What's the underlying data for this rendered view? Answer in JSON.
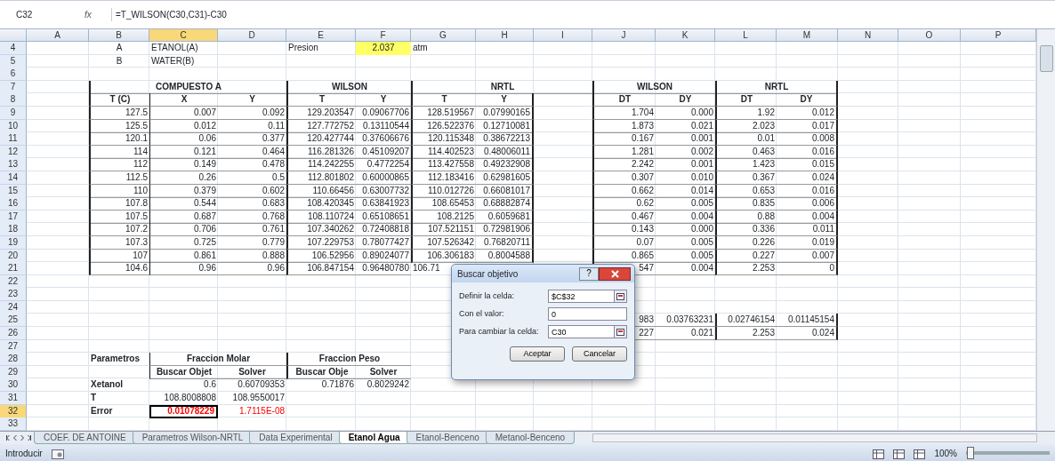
{
  "formula_bar": {
    "name_box": "C32",
    "function_label": "fx",
    "formula": "=T_WILSON(C30,C31)-C30"
  },
  "columns": [
    {
      "letter": "A",
      "selected": false
    },
    {
      "letter": "B",
      "selected": false
    },
    {
      "letter": "C",
      "selected": true
    },
    {
      "letter": "D",
      "selected": false
    },
    {
      "letter": "E",
      "selected": false
    },
    {
      "letter": "F",
      "selected": false
    },
    {
      "letter": "G",
      "selected": false
    },
    {
      "letter": "H",
      "selected": false
    },
    {
      "letter": "I",
      "selected": false
    },
    {
      "letter": "J",
      "selected": false
    },
    {
      "letter": "K",
      "selected": false
    },
    {
      "letter": "L",
      "selected": false
    },
    {
      "letter": "M",
      "selected": false
    },
    {
      "letter": "N",
      "selected": false
    },
    {
      "letter": "O",
      "selected": false
    },
    {
      "letter": "P",
      "selected": false
    }
  ],
  "rows": [
    {
      "number": "4",
      "selected": false,
      "cells": {
        "B": {
          "text": "A",
          "kind": "center"
        },
        "C": {
          "text": "ETANOL(A)",
          "kind": "label"
        },
        "E": {
          "text": "Presion",
          "kind": "label"
        },
        "F": {
          "text": "2.037",
          "kind": "input"
        },
        "G": {
          "text": "atm",
          "kind": "label"
        }
      }
    },
    {
      "number": "5",
      "selected": false,
      "cells": {
        "B": {
          "text": "B",
          "kind": "center"
        },
        "C": {
          "text": "WATER(B)",
          "kind": "label"
        }
      }
    },
    {
      "number": "6",
      "selected": false,
      "cells": {}
    },
    {
      "number": "7",
      "selected": false,
      "cells": {
        "B": {
          "text": "COMPUESTO A",
          "kind": "group"
        },
        "E": {
          "text": "WILSON",
          "kind": "group"
        },
        "G": {
          "text": "NRTL",
          "kind": "group"
        },
        "J": {
          "text": "WILSON",
          "kind": "group"
        },
        "L": {
          "text": "NRTL",
          "kind": "group"
        }
      }
    },
    {
      "number": "8",
      "selected": false,
      "cells": {
        "B": {
          "text": "T (C)",
          "kind": "head"
        },
        "C": {
          "text": "X",
          "kind": "head"
        },
        "D": {
          "text": "Y",
          "kind": "head"
        },
        "E": {
          "text": "T",
          "kind": "head"
        },
        "F": {
          "text": "Y",
          "kind": "head"
        },
        "G": {
          "text": "T",
          "kind": "head"
        },
        "H": {
          "text": "Y",
          "kind": "head"
        },
        "J": {
          "text": "DT",
          "kind": "head"
        },
        "K": {
          "text": "DY",
          "kind": "head"
        },
        "L": {
          "text": "DT",
          "kind": "head"
        },
        "M": {
          "text": "DY",
          "kind": "head"
        }
      }
    },
    {
      "number": "9",
      "selected": false,
      "cells": {
        "B": {
          "text": "127.5",
          "kind": "num"
        },
        "C": {
          "text": "0.007",
          "kind": "num"
        },
        "D": {
          "text": "0.092",
          "kind": "num"
        },
        "E": {
          "text": "129.203547",
          "kind": "num"
        },
        "F": {
          "text": "0.09067706",
          "kind": "num"
        },
        "G": {
          "text": "128.519567",
          "kind": "num"
        },
        "H": {
          "text": "0.07990165",
          "kind": "num"
        },
        "J": {
          "text": "1.704",
          "kind": "num"
        },
        "K": {
          "text": "0.000",
          "kind": "num"
        },
        "L": {
          "text": "1.92",
          "kind": "num"
        },
        "M": {
          "text": "0.012",
          "kind": "num"
        }
      }
    },
    {
      "number": "10",
      "selected": false,
      "cells": {
        "B": {
          "text": "125.5",
          "kind": "num"
        },
        "C": {
          "text": "0.012",
          "kind": "num"
        },
        "D": {
          "text": "0.11",
          "kind": "num"
        },
        "E": {
          "text": "127.772752",
          "kind": "num"
        },
        "F": {
          "text": "0.13110544",
          "kind": "num"
        },
        "G": {
          "text": "126.522376",
          "kind": "num"
        },
        "H": {
          "text": "0.12710081",
          "kind": "num"
        },
        "J": {
          "text": "1.873",
          "kind": "num"
        },
        "K": {
          "text": "0.021",
          "kind": "num"
        },
        "L": {
          "text": "2.023",
          "kind": "num"
        },
        "M": {
          "text": "0.017",
          "kind": "num"
        }
      }
    },
    {
      "number": "11",
      "selected": false,
      "cells": {
        "B": {
          "text": "120.1",
          "kind": "num"
        },
        "C": {
          "text": "0.06",
          "kind": "num"
        },
        "D": {
          "text": "0.377",
          "kind": "num"
        },
        "E": {
          "text": "120.427744",
          "kind": "num"
        },
        "F": {
          "text": "0.37606676",
          "kind": "num"
        },
        "G": {
          "text": "120.115348",
          "kind": "num"
        },
        "H": {
          "text": "0.38672213",
          "kind": "num"
        },
        "J": {
          "text": "0.167",
          "kind": "num"
        },
        "K": {
          "text": "0.001",
          "kind": "num"
        },
        "L": {
          "text": "0.01",
          "kind": "num"
        },
        "M": {
          "text": "0.008",
          "kind": "num"
        }
      }
    },
    {
      "number": "12",
      "selected": false,
      "cells": {
        "B": {
          "text": "114",
          "kind": "num"
        },
        "C": {
          "text": "0.121",
          "kind": "num"
        },
        "D": {
          "text": "0.464",
          "kind": "num"
        },
        "E": {
          "text": "116.281326",
          "kind": "num"
        },
        "F": {
          "text": "0.45109207",
          "kind": "num"
        },
        "G": {
          "text": "114.402523",
          "kind": "num"
        },
        "H": {
          "text": "0.48006011",
          "kind": "num"
        },
        "J": {
          "text": "1.281",
          "kind": "num"
        },
        "K": {
          "text": "0.002",
          "kind": "num"
        },
        "L": {
          "text": "0.463",
          "kind": "num"
        },
        "M": {
          "text": "0.016",
          "kind": "num"
        }
      }
    },
    {
      "number": "13",
      "selected": false,
      "cells": {
        "B": {
          "text": "112",
          "kind": "num"
        },
        "C": {
          "text": "0.149",
          "kind": "num"
        },
        "D": {
          "text": "0.478",
          "kind": "num"
        },
        "E": {
          "text": "114.242255",
          "kind": "num"
        },
        "F": {
          "text": "0.4772254",
          "kind": "num"
        },
        "G": {
          "text": "113.427558",
          "kind": "num"
        },
        "H": {
          "text": "0.49232908",
          "kind": "num"
        },
        "J": {
          "text": "2.242",
          "kind": "num"
        },
        "K": {
          "text": "0.001",
          "kind": "num"
        },
        "L": {
          "text": "1.423",
          "kind": "num"
        },
        "M": {
          "text": "0.015",
          "kind": "num"
        }
      }
    },
    {
      "number": "14",
      "selected": false,
      "cells": {
        "B": {
          "text": "112.5",
          "kind": "num"
        },
        "C": {
          "text": "0.26",
          "kind": "num"
        },
        "D": {
          "text": "0.5",
          "kind": "num"
        },
        "E": {
          "text": "112.801802",
          "kind": "num"
        },
        "F": {
          "text": "0.60000865",
          "kind": "num"
        },
        "G": {
          "text": "112.183416",
          "kind": "num"
        },
        "H": {
          "text": "0.62981605",
          "kind": "num"
        },
        "J": {
          "text": "0.307",
          "kind": "num"
        },
        "K": {
          "text": "0.010",
          "kind": "num"
        },
        "L": {
          "text": "0.367",
          "kind": "num"
        },
        "M": {
          "text": "0.024",
          "kind": "num"
        }
      }
    },
    {
      "number": "15",
      "selected": false,
      "cells": {
        "B": {
          "text": "110",
          "kind": "num"
        },
        "C": {
          "text": "0.379",
          "kind": "num"
        },
        "D": {
          "text": "0.602",
          "kind": "num"
        },
        "E": {
          "text": "110.66456",
          "kind": "num"
        },
        "F": {
          "text": "0.63007732",
          "kind": "num"
        },
        "G": {
          "text": "110.012726",
          "kind": "num"
        },
        "H": {
          "text": "0.66081017",
          "kind": "num"
        },
        "J": {
          "text": "0.662",
          "kind": "num"
        },
        "K": {
          "text": "0.014",
          "kind": "num"
        },
        "L": {
          "text": "0.653",
          "kind": "num"
        },
        "M": {
          "text": "0.016",
          "kind": "num"
        }
      }
    },
    {
      "number": "16",
      "selected": false,
      "cells": {
        "B": {
          "text": "107.8",
          "kind": "num"
        },
        "C": {
          "text": "0.544",
          "kind": "num"
        },
        "D": {
          "text": "0.683",
          "kind": "num"
        },
        "E": {
          "text": "108.420345",
          "kind": "num"
        },
        "F": {
          "text": "0.63841923",
          "kind": "num"
        },
        "G": {
          "text": "108.65453",
          "kind": "num"
        },
        "H": {
          "text": "0.68882874",
          "kind": "num"
        },
        "J": {
          "text": "0.62",
          "kind": "num"
        },
        "K": {
          "text": "0.005",
          "kind": "num"
        },
        "L": {
          "text": "0.835",
          "kind": "num"
        },
        "M": {
          "text": "0.006",
          "kind": "num"
        }
      }
    },
    {
      "number": "17",
      "selected": false,
      "cells": {
        "B": {
          "text": "107.5",
          "kind": "num"
        },
        "C": {
          "text": "0.687",
          "kind": "num"
        },
        "D": {
          "text": "0.768",
          "kind": "num"
        },
        "E": {
          "text": "108.110724",
          "kind": "num"
        },
        "F": {
          "text": "0.65108651",
          "kind": "num"
        },
        "G": {
          "text": "108.2125",
          "kind": "num"
        },
        "H": {
          "text": "0.6059681",
          "kind": "num"
        },
        "J": {
          "text": "0.467",
          "kind": "num"
        },
        "K": {
          "text": "0.004",
          "kind": "num"
        },
        "L": {
          "text": "0.88",
          "kind": "num"
        },
        "M": {
          "text": "0.004",
          "kind": "num"
        }
      }
    },
    {
      "number": "18",
      "selected": false,
      "cells": {
        "B": {
          "text": "107.2",
          "kind": "num"
        },
        "C": {
          "text": "0.706",
          "kind": "num"
        },
        "D": {
          "text": "0.761",
          "kind": "num"
        },
        "E": {
          "text": "107.340262",
          "kind": "num"
        },
        "F": {
          "text": "0.72408818",
          "kind": "num"
        },
        "G": {
          "text": "107.521151",
          "kind": "num"
        },
        "H": {
          "text": "0.72981906",
          "kind": "num"
        },
        "J": {
          "text": "0.143",
          "kind": "num"
        },
        "K": {
          "text": "0.000",
          "kind": "num"
        },
        "L": {
          "text": "0.336",
          "kind": "num"
        },
        "M": {
          "text": "0.011",
          "kind": "num"
        }
      }
    },
    {
      "number": "19",
      "selected": false,
      "cells": {
        "B": {
          "text": "107.3",
          "kind": "num"
        },
        "C": {
          "text": "0.725",
          "kind": "num"
        },
        "D": {
          "text": "0.779",
          "kind": "num"
        },
        "E": {
          "text": "107.229753",
          "kind": "num"
        },
        "F": {
          "text": "0.78077427",
          "kind": "num"
        },
        "G": {
          "text": "107.526342",
          "kind": "num"
        },
        "H": {
          "text": "0.76820711",
          "kind": "num"
        },
        "J": {
          "text": "0.07",
          "kind": "num"
        },
        "K": {
          "text": "0.005",
          "kind": "num"
        },
        "L": {
          "text": "0.226",
          "kind": "num"
        },
        "M": {
          "text": "0.019",
          "kind": "num"
        }
      }
    },
    {
      "number": "20",
      "selected": false,
      "cells": {
        "B": {
          "text": "107",
          "kind": "num"
        },
        "C": {
          "text": "0.861",
          "kind": "num"
        },
        "D": {
          "text": "0.888",
          "kind": "num"
        },
        "E": {
          "text": "106.52956",
          "kind": "num"
        },
        "F": {
          "text": "0.89024077",
          "kind": "num"
        },
        "G": {
          "text": "106.306183",
          "kind": "num"
        },
        "H": {
          "text": "0.8004588",
          "kind": "num"
        },
        "J": {
          "text": "0.865",
          "kind": "num"
        },
        "K": {
          "text": "0.005",
          "kind": "num"
        },
        "L": {
          "text": "0.227",
          "kind": "num"
        },
        "M": {
          "text": "0.007",
          "kind": "num"
        }
      }
    },
    {
      "number": "21",
      "selected": false,
      "cells": {
        "B": {
          "text": "104.6",
          "kind": "num"
        },
        "C": {
          "text": "0.96",
          "kind": "num"
        },
        "D": {
          "text": "0.96",
          "kind": "num"
        },
        "E": {
          "text": "106.847154",
          "kind": "num"
        },
        "F": {
          "text": "0.96480780",
          "kind": "num"
        },
        "G": {
          "text": "106.71",
          "kind": "cut"
        },
        "J": {
          "text": "547",
          "kind": "num"
        },
        "K": {
          "text": "0.004",
          "kind": "num"
        },
        "L": {
          "text": "2.253",
          "kind": "num"
        },
        "M": {
          "text": "0",
          "kind": "num"
        }
      }
    },
    {
      "number": "22",
      "selected": false,
      "cells": {}
    },
    {
      "number": "23",
      "selected": false,
      "cells": {}
    },
    {
      "number": "24",
      "selected": false,
      "cells": {}
    },
    {
      "number": "25",
      "selected": false,
      "cells": {
        "J": {
          "text": "983",
          "kind": "num"
        },
        "K": {
          "text": "0.03763231",
          "kind": "num"
        },
        "L": {
          "text": "0.02746154",
          "kind": "num"
        },
        "M": {
          "text": "0.01145154",
          "kind": "num"
        }
      }
    },
    {
      "number": "26",
      "selected": false,
      "cells": {
        "J": {
          "text": "227",
          "kind": "num"
        },
        "K": {
          "text": "0.021",
          "kind": "num"
        },
        "L": {
          "text": "2.253",
          "kind": "num"
        },
        "M": {
          "text": "0.024",
          "kind": "num"
        }
      }
    },
    {
      "number": "27",
      "selected": false,
      "cells": {}
    },
    {
      "number": "28",
      "selected": false,
      "cells": {
        "B": {
          "text": "Parametros",
          "kind": "bold"
        },
        "C": {
          "text": "Fraccion Molar",
          "kind": "group"
        },
        "E": {
          "text": "Fraccion Peso",
          "kind": "group"
        }
      }
    },
    {
      "number": "29",
      "selected": false,
      "cells": {
        "C": {
          "text": "Buscar Objet",
          "kind": "head"
        },
        "D": {
          "text": "Solver",
          "kind": "head"
        },
        "E": {
          "text": "Buscar Obje",
          "kind": "head"
        },
        "F": {
          "text": "Solver",
          "kind": "head"
        }
      }
    },
    {
      "number": "30",
      "selected": false,
      "cells": {
        "B": {
          "text": "Xetanol",
          "kind": "bold"
        },
        "C": {
          "text": "0.6",
          "kind": "value"
        },
        "D": {
          "text": "0.60709353",
          "kind": "value"
        },
        "E": {
          "text": "0.71876",
          "kind": "value"
        },
        "F": {
          "text": "0.8029242",
          "kind": "value"
        }
      }
    },
    {
      "number": "31",
      "selected": false,
      "cells": {
        "B": {
          "text": "T",
          "kind": "bold"
        },
        "C": {
          "text": "108.8008808",
          "kind": "value"
        },
        "D": {
          "text": "108.9550017",
          "kind": "value"
        }
      }
    },
    {
      "number": "32",
      "selected": true,
      "cells": {
        "B": {
          "text": "Error",
          "kind": "bold"
        },
        "C": {
          "text": "0.01078229",
          "kind": "value",
          "color": "#ff0000"
        },
        "D": {
          "text": "1.7115E-08",
          "kind": "value",
          "color": "#ff0000"
        }
      }
    },
    {
      "number": "33",
      "selected": false,
      "cells": {}
    }
  ],
  "dialog": {
    "title": "Buscar objetivo",
    "help": "?",
    "fields": [
      {
        "label": "Definir la celda:",
        "value": "$C$32",
        "picker": true
      },
      {
        "label": "Con el valor:",
        "value": "0",
        "picker": false
      },
      {
        "label": "Para cambiar la celda:",
        "value": "C30",
        "picker": true
      }
    ],
    "buttons": [
      "Aceptar",
      "Cancelar"
    ]
  },
  "sheet_tabs": [
    {
      "label": "COEF. DE ANTOINE",
      "selected": false
    },
    {
      "label": "Parametros Wilson-NRTL",
      "selected": false
    },
    {
      "label": "Data Experimental",
      "selected": false
    },
    {
      "label": "Etanol Agua",
      "selected": true
    },
    {
      "label": "Etanol-Benceno",
      "selected": false
    },
    {
      "label": "Metanol-Benceno",
      "selected": false
    }
  ],
  "status_bar": {
    "mode": "Introducir",
    "zoom": "100%",
    "zoom_slider": {
      "level": 0.05
    }
  }
}
